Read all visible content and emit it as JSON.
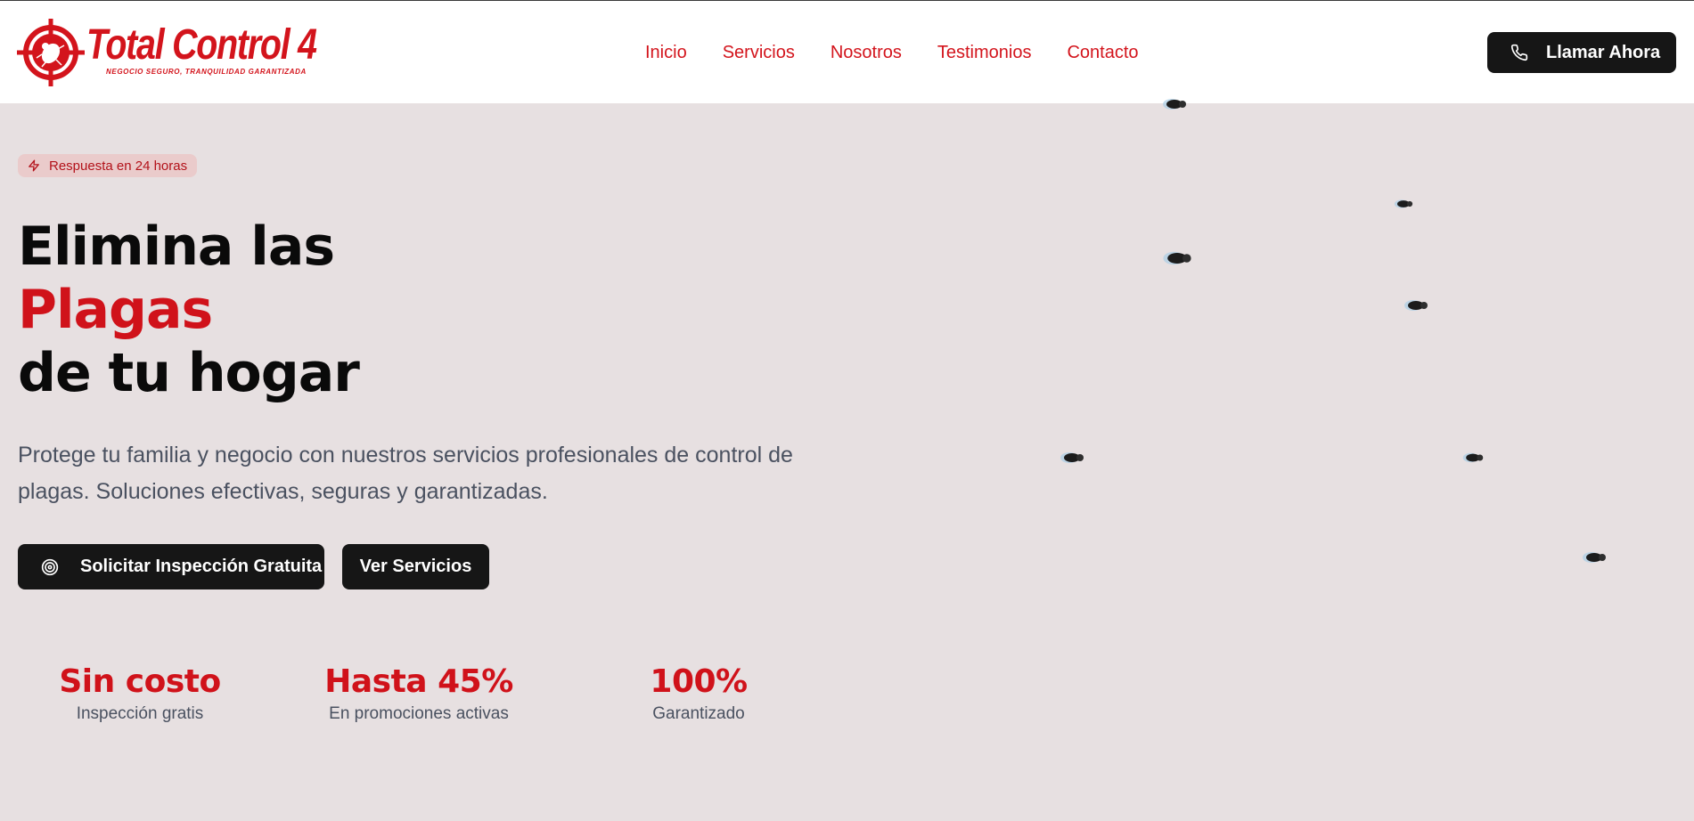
{
  "brand": {
    "name": "Total Control 4",
    "tagline": "NEGOCIO SEGURO, TRANQUILIDAD GARANTIZADA",
    "color": "#d3141c"
  },
  "nav": {
    "items": [
      {
        "label": "Inicio"
      },
      {
        "label": "Servicios"
      },
      {
        "label": "Nosotros"
      },
      {
        "label": "Testimonios"
      },
      {
        "label": "Contacto"
      }
    ]
  },
  "header": {
    "call_label": "Llamar Ahora",
    "call_icon": "phone-icon"
  },
  "hero": {
    "badge": {
      "icon": "lightning-icon",
      "label": "Respuesta en 24 horas"
    },
    "headline_line1": "Elimina las",
    "headline_accent": "Plagas",
    "headline_line3": "de tu hogar",
    "subtitle_line1": "Protege tu familia y negocio con nuestros servicios profesionales de control de",
    "subtitle_line2": "plagas. Soluciones efectivas, seguras y garantizadas.",
    "primary_button": {
      "icon": "target-icon",
      "label": "Solicitar Inspección Gratuita"
    },
    "secondary_button": {
      "label": "Ver Servicios"
    }
  },
  "stats": [
    {
      "value": "Sin costo",
      "label": "Inspección gratis"
    },
    {
      "value": "Hasta 45%",
      "label": "En promociones activas"
    },
    {
      "value": "100%",
      "label": "Garantizado"
    }
  ],
  "colors": {
    "accent": "#d0121a",
    "button_dark": "#161616",
    "hero_bg": "#e7e0e1",
    "badge_bg": "#eacbcb"
  }
}
